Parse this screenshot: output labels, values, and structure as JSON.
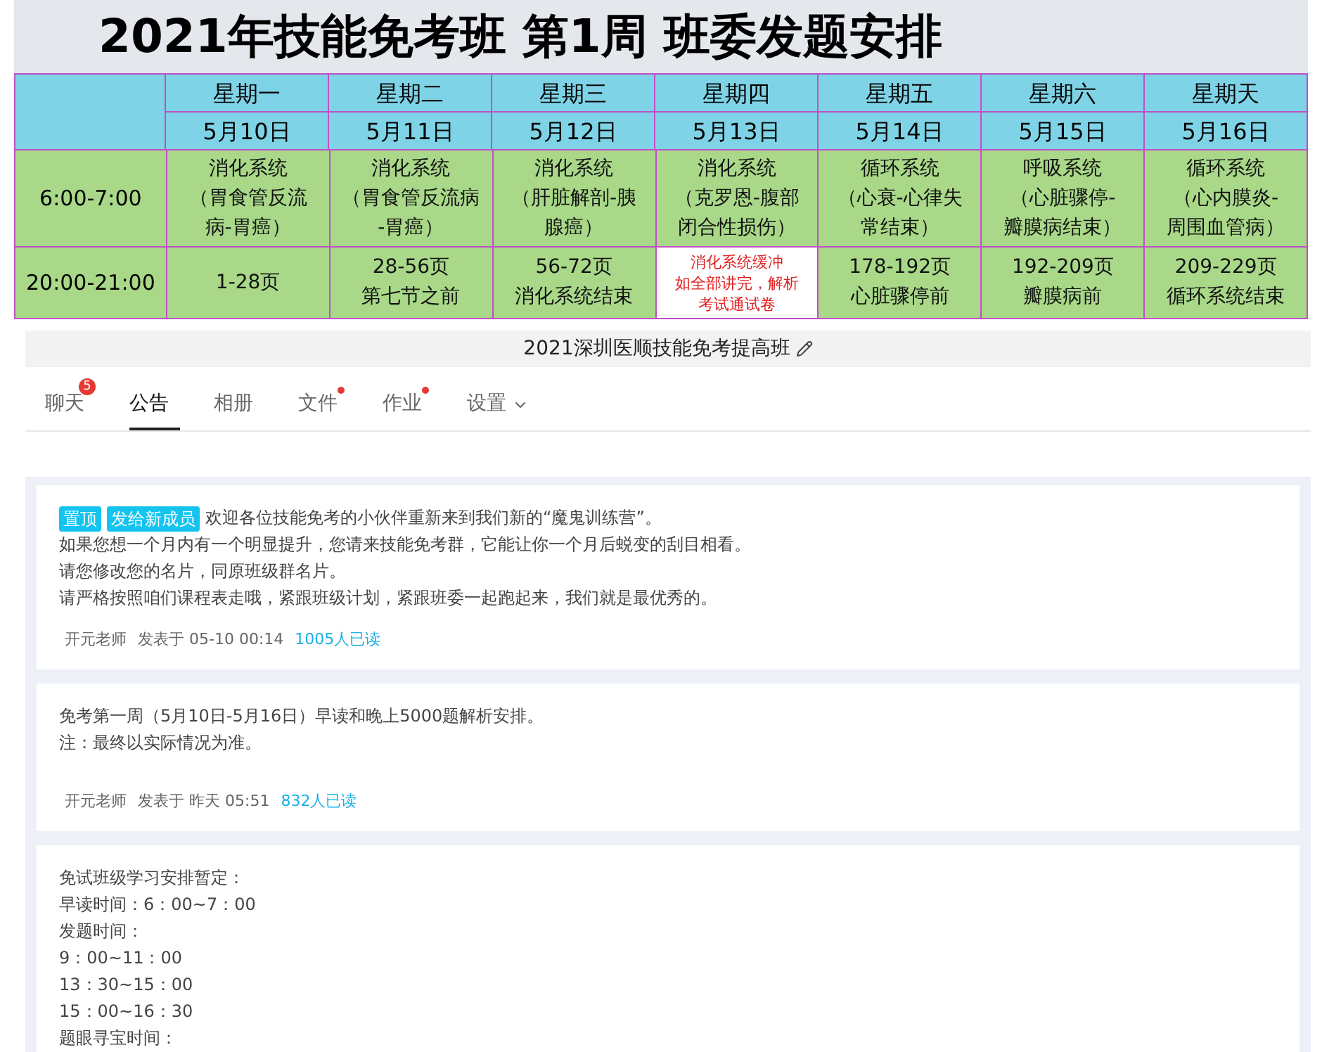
{
  "schedule": {
    "title": "2021年技能免考班 第1周 班委发题安排",
    "days": [
      {
        "weekday": "星期一",
        "date": "5月10日"
      },
      {
        "weekday": "星期二",
        "date": "5月11日"
      },
      {
        "weekday": "星期三",
        "date": "5月12日"
      },
      {
        "weekday": "星期四",
        "date": "5月13日"
      },
      {
        "weekday": "星期五",
        "date": "5月14日"
      },
      {
        "weekday": "星期六",
        "date": "5月15日"
      },
      {
        "weekday": "星期天",
        "date": "5月16日"
      }
    ],
    "rows": [
      {
        "time": "6:00-7:00",
        "cells": [
          {
            "kind": "normal",
            "lines": [
              "消化系统",
              "（胃食管反流",
              "病-胃癌）"
            ]
          },
          {
            "kind": "normal",
            "lines": [
              "消化系统",
              "（胃食管反流病",
              "-胃癌）"
            ]
          },
          {
            "kind": "normal",
            "lines": [
              "消化系统",
              "（肝脏解剖-胰",
              "腺癌）"
            ]
          },
          {
            "kind": "normal",
            "lines": [
              "消化系统",
              "（克罗恩-腹部",
              "闭合性损伤）"
            ]
          },
          {
            "kind": "normal",
            "lines": [
              "循环系统",
              "（心衰-心律失",
              "常结束）"
            ]
          },
          {
            "kind": "normal",
            "lines": [
              "呼吸系统",
              "（心脏骤停-",
              "瓣膜病结束）"
            ]
          },
          {
            "kind": "normal",
            "lines": [
              "循环系统",
              "（心内膜炎-",
              "周围血管病）"
            ]
          }
        ]
      },
      {
        "time": "20:00-21:00",
        "cells": [
          {
            "kind": "normal",
            "lines": [
              "1-28页"
            ]
          },
          {
            "kind": "normal",
            "lines": [
              "28-56页",
              "第七节之前"
            ]
          },
          {
            "kind": "normal",
            "lines": [
              "56-72页",
              "消化系统结束"
            ]
          },
          {
            "kind": "alert",
            "lines": [
              "消化系统缓冲",
              "如全部讲完，解析",
              "考试通试卷"
            ]
          },
          {
            "kind": "normal",
            "lines": [
              "178-192页",
              "心脏骤停前"
            ]
          },
          {
            "kind": "normal",
            "lines": [
              "192-209页",
              "瓣膜病前"
            ]
          },
          {
            "kind": "normal",
            "lines": [
              "209-229页",
              "循环系统结束"
            ]
          }
        ]
      }
    ]
  },
  "group": {
    "title": "2021深圳医顺技能免考提高班",
    "tabs": [
      {
        "label": "聊天",
        "selected": false,
        "badge": "5",
        "dot": false,
        "kind": "plain"
      },
      {
        "label": "公告",
        "selected": true,
        "dot": false,
        "kind": "plain"
      },
      {
        "label": "相册",
        "selected": false,
        "dot": false,
        "kind": "plain"
      },
      {
        "label": "文件",
        "selected": false,
        "dot": true,
        "kind": "plain"
      },
      {
        "label": "作业",
        "selected": false,
        "dot": true,
        "kind": "plain"
      },
      {
        "label": "设置",
        "selected": false,
        "dot": false,
        "kind": "dropdown"
      }
    ],
    "announcements": [
      {
        "tags": [
          "置顶",
          "发给新成员"
        ],
        "lines": [
          "欢迎各位技能免考的小伙伴重新来到我们新的“魔鬼训练营”。",
          "如果您想一个月内有一个明显提升，您请来技能免考群，它能让你一个月后蜕变的刮目相看。",
          "请您修改您的名片，同原班级群名片。",
          "请严格按照咱们课程表走哦，紧跟班级计划，紧跟班委一起跑起来，我们就是最优秀的。"
        ],
        "author": "开元老师",
        "posted": "发表于 05-10 00:14",
        "reads": "1005人已读"
      },
      {
        "lines": [
          "免考第一周（5月10日-5月16日）早读和晚上5000题解析安排。",
          "注：最终以实际情况为准。"
        ],
        "author": "开元老师",
        "posted": "发表于 昨天 05:51",
        "reads": "832人已读"
      },
      {
        "lines": [
          "免试班级学习安排暂定：",
          "早读时间：6：00~7：00",
          "发题时间：",
          "9：00~11：00",
          "13：30~15：00",
          "15：00~16：30",
          "题眼寻宝时间："
        ]
      }
    ]
  }
}
